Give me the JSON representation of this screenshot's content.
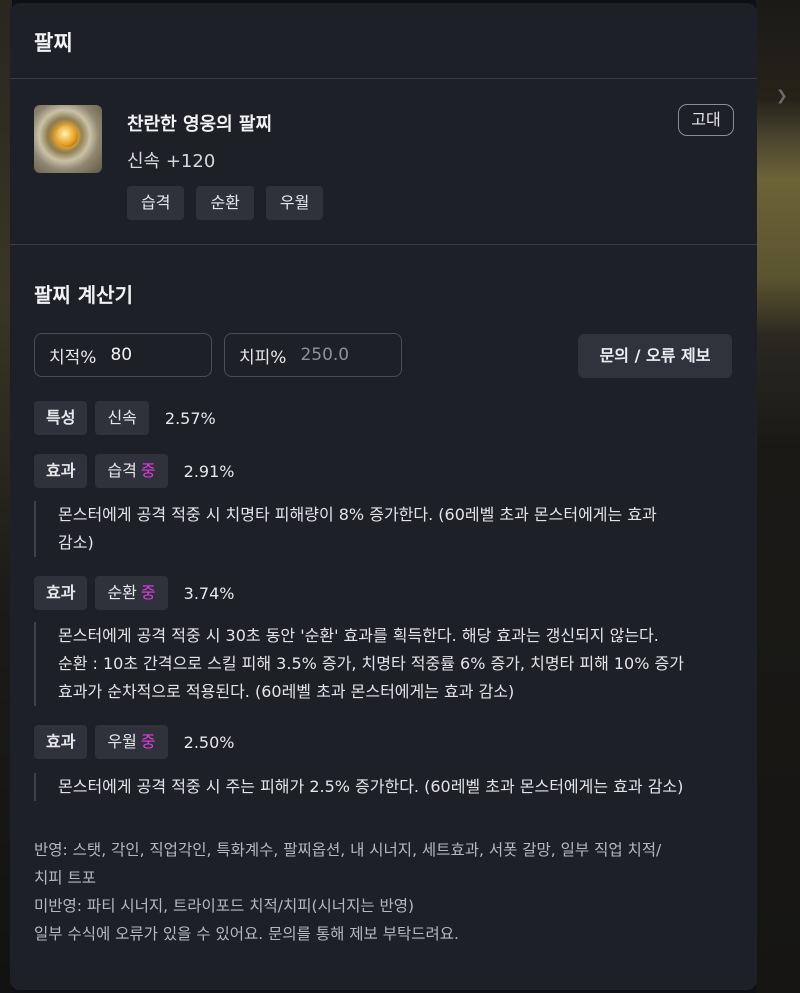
{
  "panel": {
    "title": "팔찌"
  },
  "item": {
    "icon": "bracelet-icon",
    "name": "찬란한 영웅의 팔찌",
    "stat": "신속 +120",
    "grade": "고대",
    "tags": [
      "습격",
      "순환",
      "우월"
    ]
  },
  "calculator": {
    "title": "팔찌 계산기",
    "crit_label": "치적%",
    "crit_value": "80",
    "critdmg_label": "치피%",
    "critdmg_placeholder": "250.0",
    "report_button": "문의 / 오류 제보"
  },
  "trait": {
    "type": "특성",
    "name": "신속",
    "value": "2.57%"
  },
  "effects": [
    {
      "type": "효과",
      "name": "습격",
      "tier": "중",
      "value": "2.91%",
      "lines": [
        "몬스터에게 공격 적중 시 치명타 피해량이 8% 증가한다. (60레벨 초과 몬스터에게는 효과",
        "감소)"
      ]
    },
    {
      "type": "효과",
      "name": "순환",
      "tier": "중",
      "value": "3.74%",
      "lines": [
        "몬스터에게 공격 적중 시 30초 동안 '순환' 효과를 획득한다. 해당 효과는 갱신되지 않는다.",
        "순환 : 10초 간격으로 스킬 피해 3.5% 증가, 치명타 적중률 6% 증가, 치명타 피해 10% 증가",
        "효과가 순차적으로 적용된다. (60레벨 초과 몬스터에게는 효과 감소)"
      ]
    },
    {
      "type": "효과",
      "name": "우월",
      "tier": "중",
      "value": "2.50%",
      "lines": [
        "몬스터에게 공격 적중 시 주는 피해가 2.5% 증가한다. (60레벨 초과 몬스터에게는 효과 감소)"
      ]
    }
  ],
  "footer": {
    "lines": [
      "반영: 스탯, 각인, 직업각인, 특화계수, 팔찌옵션, 내 시너지, 세트효과, 서폿 갈망, 일부 직업 치적/",
      "치피 트포",
      "미반영: 파티 시너지, 트라이포드 치적/치피(시너지는 반영)",
      "일부 수식에 오류가 있을 수 있어요. 문의를 통해 제보 부탁드려요."
    ]
  },
  "colors": {
    "tier_mid": "#e23be6",
    "panel_bg": "#1e2027"
  }
}
